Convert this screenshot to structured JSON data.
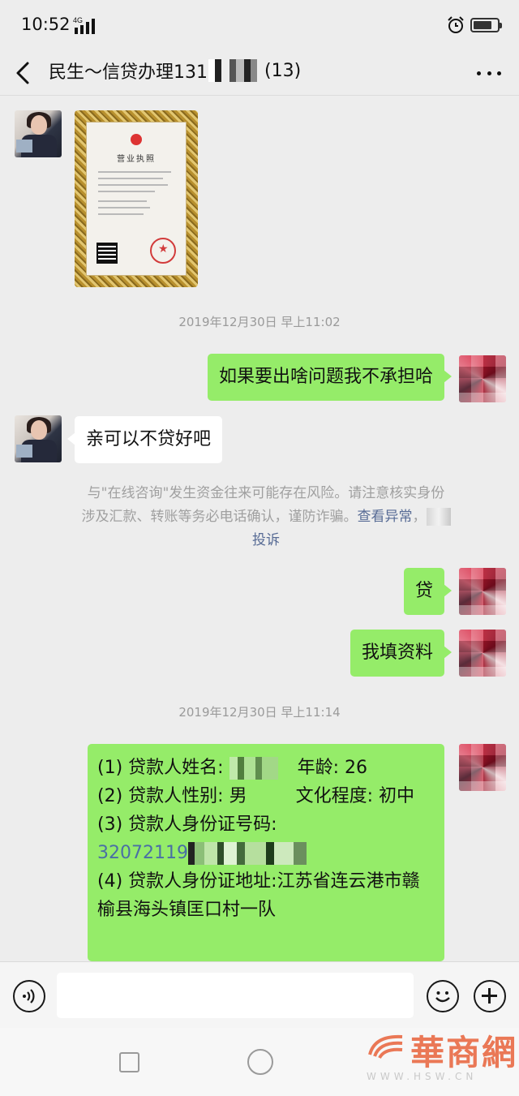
{
  "status_bar": {
    "time": "10:52",
    "network": "4G",
    "battery_level": 0.8
  },
  "header": {
    "title_prefix": "民生～信贷办理131",
    "title_suffix": "(13)"
  },
  "messages": {
    "timestamp_1": "2019年12月30日 早上11:02",
    "msg_1": "如果要出啥问题我不承担哈",
    "msg_2": "亲可以不贷好吧",
    "notice_line1": "与\"在线咨询\"发生资金往来可能存在风险。请注意核实身份",
    "notice_line2": "涉及汇款、转账等务必电话确认，谨防诈骗。",
    "notice_link_check": "查看异常",
    "notice_link_report": "投诉",
    "msg_3": "贷",
    "msg_4": "我填资料",
    "timestamp_2": "2019年12月30日 早上11:14"
  },
  "license_image": {
    "title": "营业执照"
  },
  "form": {
    "row1_label": "(1) 贷款人姓名:",
    "row1_age_label": "年龄:",
    "row1_age": "26",
    "row2_label": "(2) 贷款人性别:",
    "row2_gender": "男",
    "row2_edu_label": "文化程度:",
    "row2_edu": "初中",
    "row3_label": "(3) 贷款人身份证号码:",
    "row3_id_prefix": "32072119",
    "row4_label": "(4) 贷款人身份证地址:",
    "row4_addr": "江苏省连云港市赣榆县海头镇匡口村一队"
  },
  "watermark": {
    "text": "華商網",
    "url": "WWW.HSW.CN"
  }
}
